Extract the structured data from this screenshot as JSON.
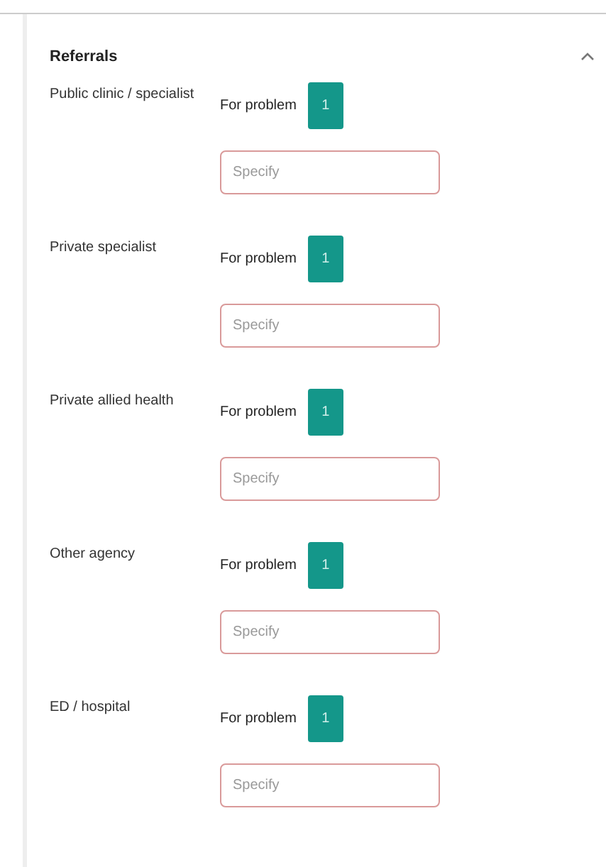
{
  "section": {
    "title": "Referrals",
    "expanded": true
  },
  "referrals": [
    {
      "label": "Public clinic / specialist",
      "problem_label": "For problem",
      "problems": [
        {
          "label": "1",
          "selected": true
        }
      ],
      "placeholder": "Specify"
    },
    {
      "label": "Private specialist",
      "problem_label": "For problem",
      "problems": [
        {
          "label": "1",
          "selected": true
        }
      ],
      "placeholder": "Specify"
    },
    {
      "label": "Private allied health",
      "problem_label": "For problem",
      "problems": [
        {
          "label": "1",
          "selected": true
        }
      ],
      "placeholder": "Specify"
    },
    {
      "label": "Other agency",
      "problem_label": "For problem",
      "problems": [
        {
          "label": "1",
          "selected": true
        }
      ],
      "placeholder": "Specify"
    },
    {
      "label": "ED / hospital",
      "problem_label": "For problem",
      "problems": [
        {
          "label": "1",
          "selected": true
        }
      ],
      "placeholder": "Specify"
    }
  ]
}
